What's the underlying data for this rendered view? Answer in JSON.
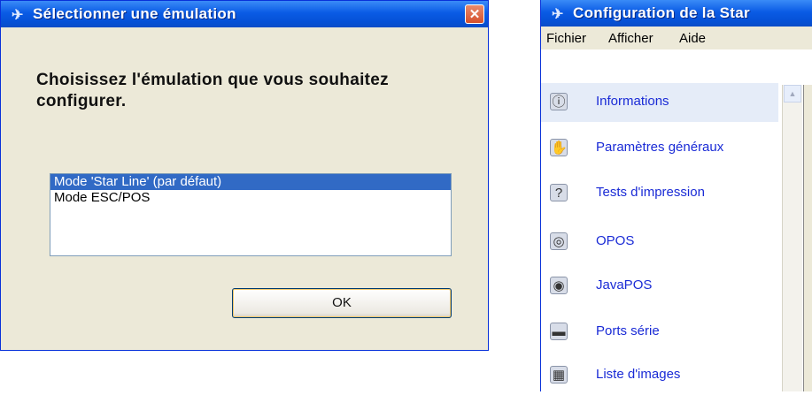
{
  "dialog": {
    "title": "Sélectionner une émulation",
    "close_glyph": "✕",
    "prompt": "Choisissez l'émulation que vous souhaitez configurer.",
    "options": [
      {
        "label": "Mode 'Star Line' (par défaut)",
        "selected": true
      },
      {
        "label": "Mode ESC/POS",
        "selected": false
      }
    ],
    "ok_label": "OK"
  },
  "config_window": {
    "title": "Configuration de la Star",
    "menu": [
      "Fichier",
      "Afficher",
      "Aide"
    ],
    "nav_items": [
      {
        "label": "Informations",
        "icon": "info-icon",
        "glyph": "ⓘ",
        "selected": true
      },
      {
        "label": "Paramètres généraux",
        "icon": "settings-hand-icon",
        "glyph": "✋"
      },
      {
        "label": "Tests d'impression",
        "icon": "print-test-icon",
        "glyph": "?"
      },
      {
        "label": "OPOS",
        "icon": "opos-icon",
        "glyph": "◎"
      },
      {
        "label": "JavaPOS",
        "icon": "javapos-icon",
        "glyph": "◉"
      },
      {
        "label": "Ports série",
        "icon": "serial-port-icon",
        "glyph": "▬"
      },
      {
        "label": "Liste d'images",
        "icon": "image-list-icon",
        "glyph": "▦"
      }
    ]
  },
  "colors": {
    "titlebar": "#0a5be5",
    "selection": "#316ac5",
    "link": "#1a2bd6"
  }
}
